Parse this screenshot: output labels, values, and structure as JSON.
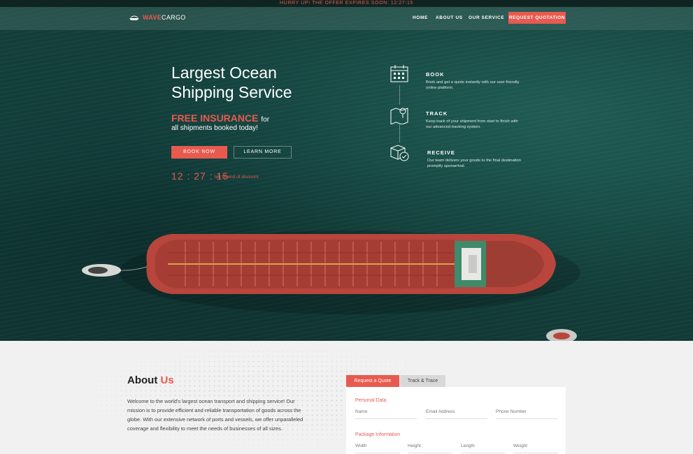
{
  "announcement": "HURRY UP! THE OFFER EXPIRES SOON: 12:27:15",
  "brand": {
    "part1": "WAVE",
    "part2": "CARGO"
  },
  "nav": {
    "home": "HOME",
    "about": "ABOUT US",
    "service": "OUR SERVICE",
    "cta": "REQUEST QUOTATION"
  },
  "hero": {
    "title_line1": "Largest Ocean",
    "title_line2": "Shipping Service",
    "offer_highlight": "FREE INSURANCE",
    "offer_tail": "for",
    "offer_line2": "all shipments booked today!",
    "book_label": "BOOK NOW",
    "more_label": "LEARN MORE",
    "timer": "12 : 27 : 15",
    "timer_note": "left till end of discount"
  },
  "steps": [
    {
      "icon": "calendar-icon",
      "title": "BOOK",
      "text": "Book and get a quote instantly with our user-friendly online platform."
    },
    {
      "icon": "map-pin-icon",
      "title": "TRACK",
      "text": "Keep track of your shipment from start to finish with our advanced tracking system."
    },
    {
      "icon": "package-check-icon",
      "title": "RECEIVE",
      "text": "Our team delivers your goods to the final destination promptly uponarrival."
    }
  ],
  "about": {
    "title": "About",
    "title_accent": "Us",
    "text": "Welcome to the world's largest ocean transport and shipping service! Our mission is to provide efficient and reliable transportation of goods across the globe. With our extensive network of ports and vessels, we offer unparalleled coverage and flexibility to meet the needs of businesses of all sizes."
  },
  "form": {
    "tab_quote": "Request a Quote",
    "tab_track": "Track & Trace",
    "personal_label": "Personal Data",
    "name_placeholder": "Name",
    "email_placeholder": "Email Address",
    "phone_placeholder": "Phone Number",
    "package_label": "Package Information",
    "width_placeholder": "Width",
    "height_placeholder": "Height",
    "length_placeholder": "Length",
    "weight_placeholder": "Weight"
  },
  "colors": {
    "accent": "#e85a4f",
    "hero_dark": "#123b37",
    "ship_hull": "#b8463d"
  }
}
